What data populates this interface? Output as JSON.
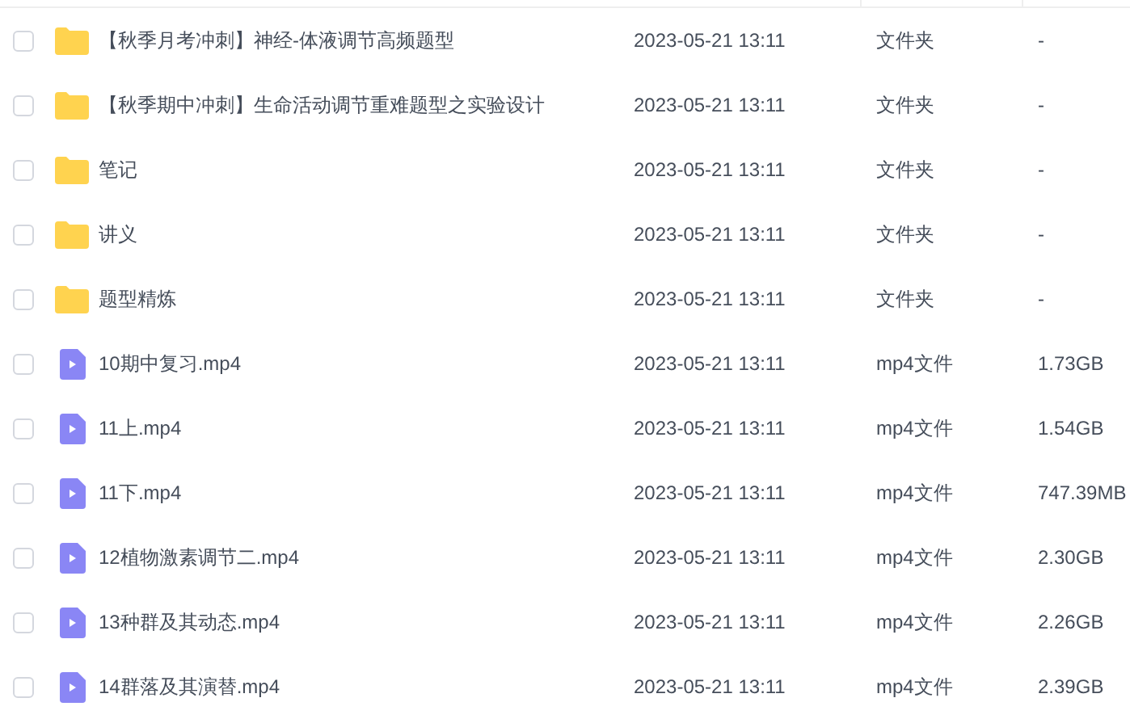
{
  "rows": [
    {
      "kind": "folder",
      "checked": false,
      "name": "【秋季月考冲刺】神经-体液调节高频题型",
      "date": "2023-05-21 13:11",
      "type": "文件夹",
      "size": "-"
    },
    {
      "kind": "folder",
      "checked": false,
      "name": "【秋季期中冲刺】生命活动调节重难题型之实验设计",
      "date": "2023-05-21 13:11",
      "type": "文件夹",
      "size": "-"
    },
    {
      "kind": "folder",
      "checked": false,
      "name": "笔记",
      "date": "2023-05-21 13:11",
      "type": "文件夹",
      "size": "-"
    },
    {
      "kind": "folder",
      "checked": false,
      "name": "讲义",
      "date": "2023-05-21 13:11",
      "type": "文件夹",
      "size": "-"
    },
    {
      "kind": "folder",
      "checked": false,
      "name": "题型精炼",
      "date": "2023-05-21 13:11",
      "type": "文件夹",
      "size": "-"
    },
    {
      "kind": "video",
      "checked": false,
      "name": "10期中复习.mp4",
      "date": "2023-05-21 13:11",
      "type": "mp4文件",
      "size": "1.73GB"
    },
    {
      "kind": "video",
      "checked": false,
      "name": "11上.mp4",
      "date": "2023-05-21 13:11",
      "type": "mp4文件",
      "size": "1.54GB"
    },
    {
      "kind": "video",
      "checked": false,
      "name": "11下.mp4",
      "date": "2023-05-21 13:11",
      "type": "mp4文件",
      "size": "747.39MB"
    },
    {
      "kind": "video",
      "checked": false,
      "name": "12植物激素调节二.mp4",
      "date": "2023-05-21 13:11",
      "type": "mp4文件",
      "size": "2.30GB"
    },
    {
      "kind": "video",
      "checked": false,
      "name": "13种群及其动态.mp4",
      "date": "2023-05-21 13:11",
      "type": "mp4文件",
      "size": "2.26GB"
    },
    {
      "kind": "video",
      "checked": false,
      "name": "14群落及其演替.mp4",
      "date": "2023-05-21 13:11",
      "type": "mp4文件",
      "size": "2.39GB"
    }
  ]
}
